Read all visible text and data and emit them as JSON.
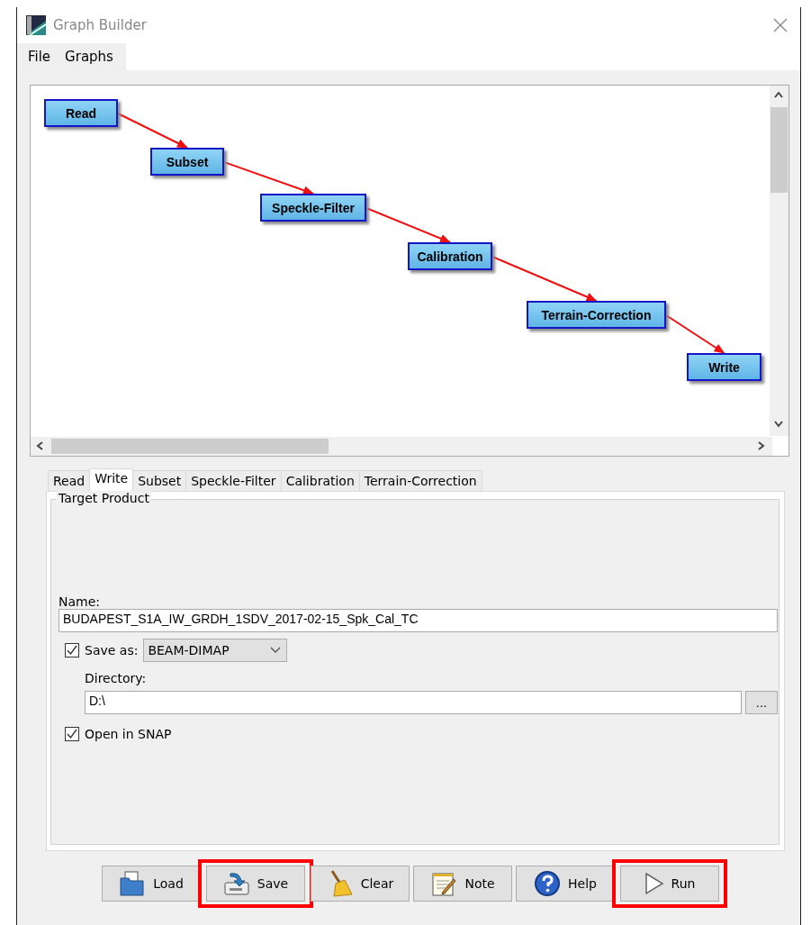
{
  "window": {
    "title": "Graph Builder"
  },
  "menu": [
    {
      "label": "File"
    },
    {
      "label": "Graphs"
    }
  ],
  "graph": {
    "nodes": [
      {
        "label": "Read"
      },
      {
        "label": "Subset"
      },
      {
        "label": "Speckle-Filter"
      },
      {
        "label": "Calibration"
      },
      {
        "label": "Terrain-Correction"
      },
      {
        "label": "Write"
      }
    ]
  },
  "tabs": [
    {
      "label": "Read",
      "selected": false
    },
    {
      "label": "Write",
      "selected": true
    },
    {
      "label": "Subset",
      "selected": false
    },
    {
      "label": "Speckle-Filter",
      "selected": false
    },
    {
      "label": "Calibration",
      "selected": false
    },
    {
      "label": "Terrain-Correction",
      "selected": false
    }
  ],
  "panel": {
    "group_title": "Target Product",
    "name_label": "Name:",
    "name_value": "BUDAPEST_S1A_IW_GRDH_1SDV_2017-02-15_Spk_Cal_TC",
    "save_as": {
      "label": "Save as:",
      "checked": true,
      "format": "BEAM-DIMAP"
    },
    "directory_label": "Directory:",
    "directory_value": "D:\\",
    "browse_button": "...",
    "open_in_snap": {
      "label": "Open in SNAP",
      "checked": true
    }
  },
  "buttons": [
    {
      "kind": "load",
      "label": "Load",
      "highlighted": false
    },
    {
      "kind": "save",
      "label": "Save",
      "highlighted": true
    },
    {
      "kind": "clear",
      "label": "Clear",
      "highlighted": false
    },
    {
      "kind": "note",
      "label": "Note",
      "highlighted": false
    },
    {
      "kind": "help",
      "label": "Help",
      "highlighted": false
    },
    {
      "kind": "run",
      "label": "Run",
      "highlighted": true
    }
  ]
}
